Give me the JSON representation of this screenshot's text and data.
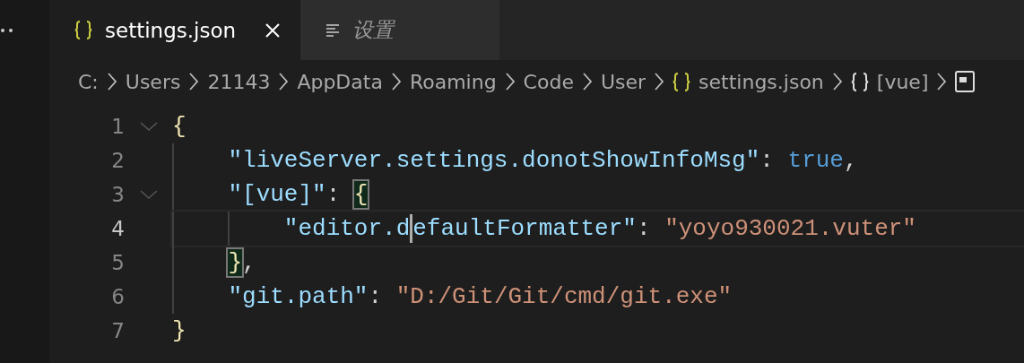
{
  "tabs": [
    {
      "label": "settings.json",
      "kind": "json",
      "selected": true,
      "preview": false
    },
    {
      "label": "设置",
      "kind": "settings",
      "selected": false,
      "preview": true
    }
  ],
  "breadcrumb": [
    {
      "label": "C:",
      "kind": "folder"
    },
    {
      "label": "Users",
      "kind": "folder"
    },
    {
      "label": "21143",
      "kind": "folder"
    },
    {
      "label": "AppData",
      "kind": "folder"
    },
    {
      "label": "Roaming",
      "kind": "folder"
    },
    {
      "label": "Code",
      "kind": "folder"
    },
    {
      "label": "User",
      "kind": "folder"
    },
    {
      "label": "settings.json",
      "kind": "file"
    },
    {
      "label": "[vue]",
      "kind": "object"
    },
    {
      "kind": "property"
    }
  ],
  "editor": {
    "lines": [
      {
        "number": "1",
        "foldable": true,
        "current": false,
        "tokens": [
          {
            "kind": "bracket",
            "text": "{",
            "matched": false
          }
        ]
      },
      {
        "number": "2",
        "foldable": false,
        "current": false,
        "tokens": [
          {
            "kind": "key",
            "text": "    \"liveServer.settings.donotShowInfoMsg\""
          },
          {
            "kind": "punct",
            "text": ": "
          },
          {
            "kind": "bool",
            "text": "true"
          },
          {
            "kind": "punct",
            "text": ","
          }
        ]
      },
      {
        "number": "3",
        "foldable": true,
        "current": false,
        "tokens": [
          {
            "kind": "key",
            "text": "    \"[vue]\""
          },
          {
            "kind": "punct",
            "text": ": "
          },
          {
            "kind": "bracket",
            "text": "{",
            "matched": true
          }
        ]
      },
      {
        "number": "4",
        "foldable": false,
        "current": true,
        "tokens": [
          {
            "kind": "key",
            "text": "        \"editor.d",
            "cursor_after": true
          },
          {
            "kind": "key",
            "text": "efaultFormatter\""
          },
          {
            "kind": "punct",
            "text": ": "
          },
          {
            "kind": "string",
            "text": "\"yoyo930021.vuter\""
          }
        ]
      },
      {
        "number": "5",
        "foldable": false,
        "current": false,
        "tokens": [
          {
            "kind": "bracket",
            "text": "    }",
            "matched": true
          },
          {
            "kind": "punct",
            "text": ","
          }
        ]
      },
      {
        "number": "6",
        "foldable": false,
        "current": false,
        "tokens": [
          {
            "kind": "key",
            "text": "    \"git.path\""
          },
          {
            "kind": "punct",
            "text": ": "
          },
          {
            "kind": "string",
            "text": "\"D:/Git/Git/cmd/git.exe\""
          }
        ]
      },
      {
        "number": "7",
        "foldable": false,
        "current": false,
        "tokens": [
          {
            "kind": "bracket",
            "text": "}",
            "matched": false
          }
        ]
      }
    ]
  }
}
